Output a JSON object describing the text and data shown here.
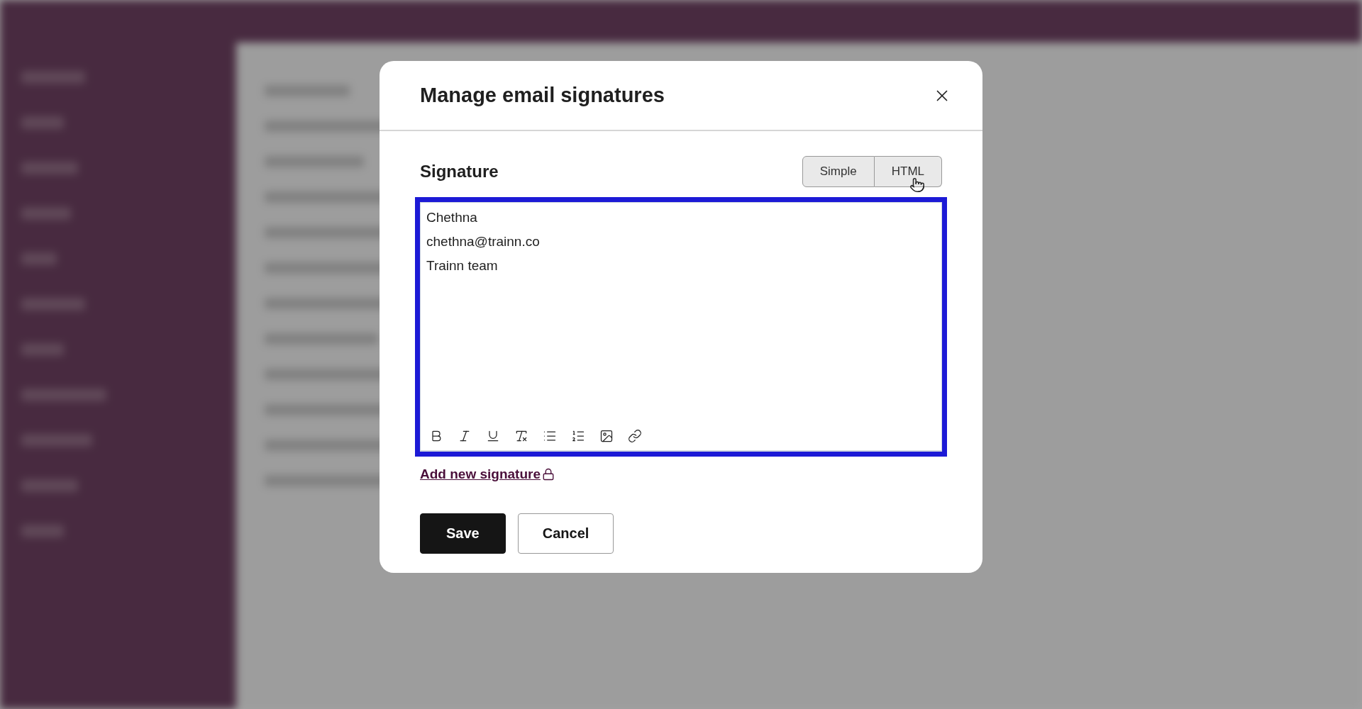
{
  "dialog": {
    "title": "Manage email signatures",
    "section_label": "Signature",
    "modes": [
      {
        "label": "Simple"
      },
      {
        "label": "HTML"
      }
    ],
    "editor": {
      "lines": [
        "Chethna",
        "chethna@trainn.co",
        "Trainn team"
      ]
    },
    "add_link": "Add new signature",
    "buttons": [
      {
        "label": "Save",
        "kind": "primary"
      },
      {
        "label": "Cancel",
        "kind": "secondary"
      }
    ]
  }
}
